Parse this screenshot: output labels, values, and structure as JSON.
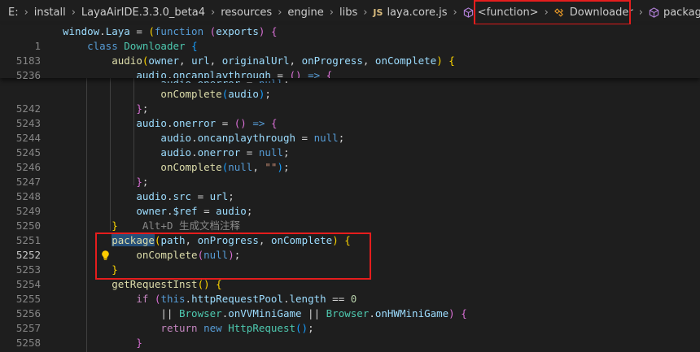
{
  "breadcrumb": {
    "drive": "E:",
    "folders": [
      "install",
      "LayaAirIDE.3.3.0_beta4",
      "resources",
      "engine",
      "libs"
    ],
    "file_badge": "JS",
    "file": "laya.core.js",
    "symbols": [
      "<function>",
      "Downloader",
      "package"
    ]
  },
  "sticky_lines": [
    {
      "number": "1",
      "code": "window.Laya = (function (exports) {"
    },
    {
      "number": "5183",
      "code": "    class Downloader {"
    },
    {
      "number": "5236",
      "code": "        audio(owner, url, originalUrl, onProgress, onComplete) {"
    },
    {
      "number": "5239",
      "code": "            audio.oncanplaythrough = () => {"
    }
  ],
  "partial_line": {
    "number": "5241",
    "code": "                audio.onerror = null;"
  },
  "lines": [
    {
      "number": "5242",
      "code": "                onComplete(audio);"
    },
    {
      "number": "5243",
      "code": "            };"
    },
    {
      "number": "5244",
      "code": "            audio.onerror = () => {"
    },
    {
      "number": "5245",
      "code": "                audio.oncanplaythrough = null;"
    },
    {
      "number": "5246",
      "code": "                audio.onerror = null;"
    },
    {
      "number": "5247",
      "code": "                onComplete(null, \"\");"
    },
    {
      "number": "5248",
      "code": "            };"
    },
    {
      "number": "5249",
      "code": "            audio.src = url;"
    },
    {
      "number": "5250",
      "code": "            owner.$ref = audio;"
    },
    {
      "number": "5251",
      "code": "        }"
    },
    {
      "number": "5252",
      "code": "        package(path, onProgress, onComplete) {"
    },
    {
      "number": "5253",
      "code": "            onComplete(null);"
    },
    {
      "number": "5254",
      "code": "        }"
    },
    {
      "number": "5255",
      "code": "        getRequestInst() {"
    },
    {
      "number": "5256",
      "code": "            if (this.httpRequestPool.length == 0"
    },
    {
      "number": "5257",
      "code": "                || Browser.onVVMiniGame || Browser.onHWMiniGame) {"
    },
    {
      "number": "5258",
      "code": "                return new HttpRequest();"
    },
    {
      "number": "5259",
      "code": "            }"
    }
  ],
  "inline_hint": "Alt+D 生成文档注释",
  "current_line": "5252",
  "colors": {
    "background": "#1e1e1e",
    "keyword": "#569cd6",
    "control": "#c586c0",
    "function": "#dcdcaa",
    "variable": "#9cdcfe",
    "class": "#4ec9b0",
    "number": "#b5cea8",
    "string": "#ce9178",
    "annotation_box": "#e51d1d",
    "selection": "#264f78"
  },
  "icons": [
    "chevron-right-icon",
    "js-file-icon",
    "cube-icon",
    "class-icon",
    "lightbulb-icon"
  ]
}
